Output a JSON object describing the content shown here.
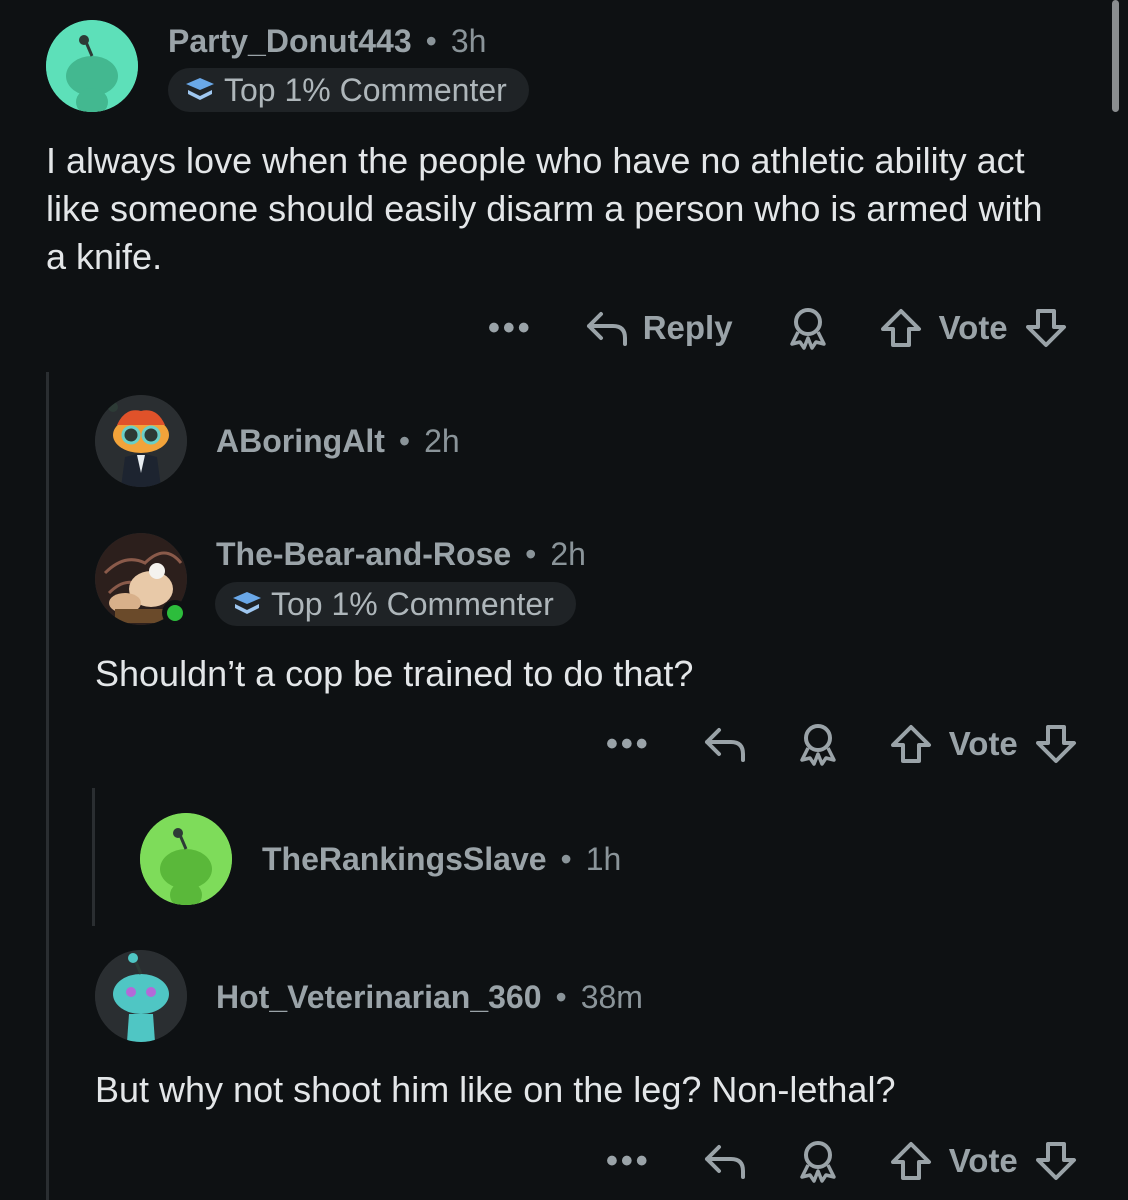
{
  "comments": [
    {
      "username": "Party_Donut443",
      "time": "3h",
      "badge": "Top 1% Commenter",
      "body": "I always love when the people who have no athletic ability act like someone should easily disarm a person who is armed with a knife.",
      "actions": {
        "more": "•••",
        "reply_label": "Reply",
        "vote_label": "Vote"
      },
      "avatar_color": "#5de0b9"
    },
    {
      "username": "ABoringAlt",
      "time": "2h",
      "avatar_color": "#2a2e31"
    },
    {
      "username": "The-Bear-and-Rose",
      "time": "2h",
      "badge": "Top 1% Commenter",
      "body": "Shouldn’t a cop be trained to do that?",
      "actions": {
        "more": "•••",
        "vote_label": "Vote"
      },
      "avatar_color": "#2a2e31",
      "online_color": "#2dbd3c"
    },
    {
      "username": "TheRankingsSlave",
      "time": "1h",
      "avatar_color": "#7edc5a"
    },
    {
      "username": "Hot_Veterinarian_360",
      "time": "38m",
      "body": "But why not shoot him like on the leg? Non-lethal?",
      "actions": {
        "more": "•••",
        "vote_label": "Vote"
      },
      "avatar_color": "#2a2e31"
    }
  ],
  "separator": "•",
  "icons": {
    "reply": "reply-arrow-icon",
    "award": "award-icon",
    "upvote": "upvote-arrow-icon",
    "downvote": "downvote-arrow-icon",
    "badge": "top-commenter-badge-icon"
  }
}
